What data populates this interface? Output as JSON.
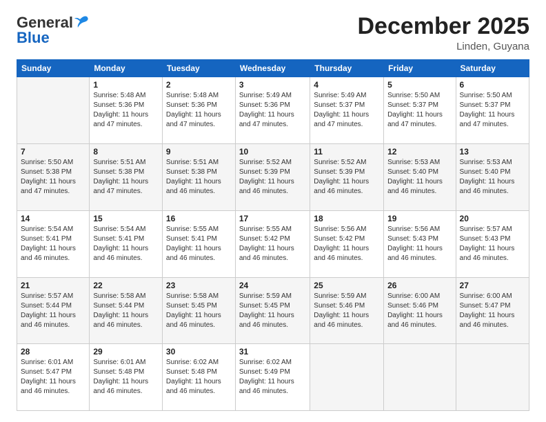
{
  "header": {
    "logo_general": "General",
    "logo_blue": "Blue",
    "month_title": "December 2025",
    "location": "Linden, Guyana"
  },
  "days_of_week": [
    "Sunday",
    "Monday",
    "Tuesday",
    "Wednesday",
    "Thursday",
    "Friday",
    "Saturday"
  ],
  "weeks": [
    [
      {
        "day": "",
        "info": ""
      },
      {
        "day": "1",
        "info": "Sunrise: 5:48 AM\nSunset: 5:36 PM\nDaylight: 11 hours\nand 47 minutes."
      },
      {
        "day": "2",
        "info": "Sunrise: 5:48 AM\nSunset: 5:36 PM\nDaylight: 11 hours\nand 47 minutes."
      },
      {
        "day": "3",
        "info": "Sunrise: 5:49 AM\nSunset: 5:36 PM\nDaylight: 11 hours\nand 47 minutes."
      },
      {
        "day": "4",
        "info": "Sunrise: 5:49 AM\nSunset: 5:37 PM\nDaylight: 11 hours\nand 47 minutes."
      },
      {
        "day": "5",
        "info": "Sunrise: 5:50 AM\nSunset: 5:37 PM\nDaylight: 11 hours\nand 47 minutes."
      },
      {
        "day": "6",
        "info": "Sunrise: 5:50 AM\nSunset: 5:37 PM\nDaylight: 11 hours\nand 47 minutes."
      }
    ],
    [
      {
        "day": "7",
        "info": "Sunrise: 5:50 AM\nSunset: 5:38 PM\nDaylight: 11 hours\nand 47 minutes."
      },
      {
        "day": "8",
        "info": "Sunrise: 5:51 AM\nSunset: 5:38 PM\nDaylight: 11 hours\nand 47 minutes."
      },
      {
        "day": "9",
        "info": "Sunrise: 5:51 AM\nSunset: 5:38 PM\nDaylight: 11 hours\nand 46 minutes."
      },
      {
        "day": "10",
        "info": "Sunrise: 5:52 AM\nSunset: 5:39 PM\nDaylight: 11 hours\nand 46 minutes."
      },
      {
        "day": "11",
        "info": "Sunrise: 5:52 AM\nSunset: 5:39 PM\nDaylight: 11 hours\nand 46 minutes."
      },
      {
        "day": "12",
        "info": "Sunrise: 5:53 AM\nSunset: 5:40 PM\nDaylight: 11 hours\nand 46 minutes."
      },
      {
        "day": "13",
        "info": "Sunrise: 5:53 AM\nSunset: 5:40 PM\nDaylight: 11 hours\nand 46 minutes."
      }
    ],
    [
      {
        "day": "14",
        "info": "Sunrise: 5:54 AM\nSunset: 5:41 PM\nDaylight: 11 hours\nand 46 minutes."
      },
      {
        "day": "15",
        "info": "Sunrise: 5:54 AM\nSunset: 5:41 PM\nDaylight: 11 hours\nand 46 minutes."
      },
      {
        "day": "16",
        "info": "Sunrise: 5:55 AM\nSunset: 5:41 PM\nDaylight: 11 hours\nand 46 minutes."
      },
      {
        "day": "17",
        "info": "Sunrise: 5:55 AM\nSunset: 5:42 PM\nDaylight: 11 hours\nand 46 minutes."
      },
      {
        "day": "18",
        "info": "Sunrise: 5:56 AM\nSunset: 5:42 PM\nDaylight: 11 hours\nand 46 minutes."
      },
      {
        "day": "19",
        "info": "Sunrise: 5:56 AM\nSunset: 5:43 PM\nDaylight: 11 hours\nand 46 minutes."
      },
      {
        "day": "20",
        "info": "Sunrise: 5:57 AM\nSunset: 5:43 PM\nDaylight: 11 hours\nand 46 minutes."
      }
    ],
    [
      {
        "day": "21",
        "info": "Sunrise: 5:57 AM\nSunset: 5:44 PM\nDaylight: 11 hours\nand 46 minutes."
      },
      {
        "day": "22",
        "info": "Sunrise: 5:58 AM\nSunset: 5:44 PM\nDaylight: 11 hours\nand 46 minutes."
      },
      {
        "day": "23",
        "info": "Sunrise: 5:58 AM\nSunset: 5:45 PM\nDaylight: 11 hours\nand 46 minutes."
      },
      {
        "day": "24",
        "info": "Sunrise: 5:59 AM\nSunset: 5:45 PM\nDaylight: 11 hours\nand 46 minutes."
      },
      {
        "day": "25",
        "info": "Sunrise: 5:59 AM\nSunset: 5:46 PM\nDaylight: 11 hours\nand 46 minutes."
      },
      {
        "day": "26",
        "info": "Sunrise: 6:00 AM\nSunset: 5:46 PM\nDaylight: 11 hours\nand 46 minutes."
      },
      {
        "day": "27",
        "info": "Sunrise: 6:00 AM\nSunset: 5:47 PM\nDaylight: 11 hours\nand 46 minutes."
      }
    ],
    [
      {
        "day": "28",
        "info": "Sunrise: 6:01 AM\nSunset: 5:47 PM\nDaylight: 11 hours\nand 46 minutes."
      },
      {
        "day": "29",
        "info": "Sunrise: 6:01 AM\nSunset: 5:48 PM\nDaylight: 11 hours\nand 46 minutes."
      },
      {
        "day": "30",
        "info": "Sunrise: 6:02 AM\nSunset: 5:48 PM\nDaylight: 11 hours\nand 46 minutes."
      },
      {
        "day": "31",
        "info": "Sunrise: 6:02 AM\nSunset: 5:49 PM\nDaylight: 11 hours\nand 46 minutes."
      },
      {
        "day": "",
        "info": ""
      },
      {
        "day": "",
        "info": ""
      },
      {
        "day": "",
        "info": ""
      }
    ]
  ]
}
